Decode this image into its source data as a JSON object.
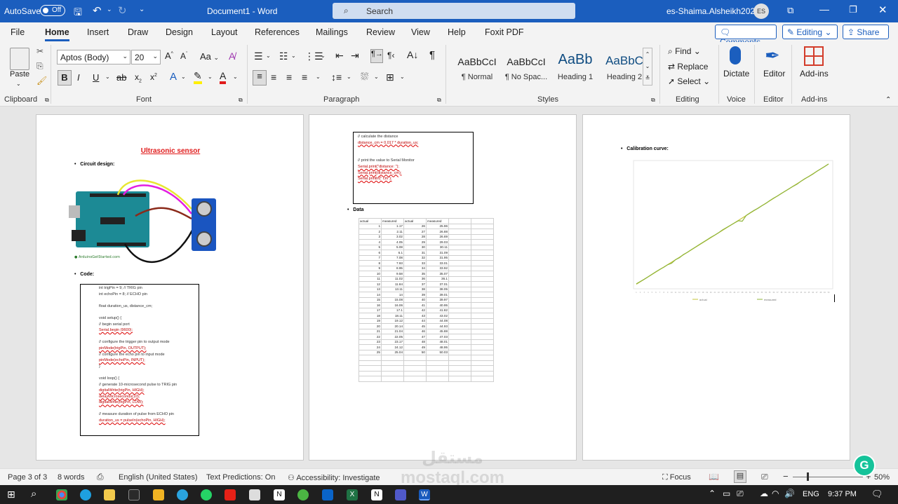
{
  "titlebar": {
    "autosave_label": "AutoSave",
    "autosave_state": "Off",
    "doc_title": "Document1 - Word",
    "search_placeholder": "Search",
    "user_name": "es-Shaima.Alsheikh2026",
    "user_initials": "ES"
  },
  "tabs": [
    "File",
    "Home",
    "Insert",
    "Draw",
    "Design",
    "Layout",
    "References",
    "Mailings",
    "Review",
    "View",
    "Help",
    "Foxit PDF"
  ],
  "active_tab": "Home",
  "actions": {
    "comments": "Comments",
    "editing": "Editing",
    "share": "Share"
  },
  "ribbon": {
    "clipboard": {
      "paste": "Paste",
      "label": "Clipboard"
    },
    "font": {
      "name": "Aptos (Body)",
      "size": "20",
      "label": "Font",
      "change_case": "Aa"
    },
    "paragraph": {
      "label": "Paragraph"
    },
    "styles": {
      "label": "Styles",
      "items": [
        {
          "preview": "AaBbCcI",
          "name": "¶ Normal"
        },
        {
          "preview": "AaBbCcI",
          "name": "¶ No Spac..."
        },
        {
          "preview": "AaBb",
          "name": "Heading 1"
        },
        {
          "preview": "AaBbC",
          "name": "Heading 2"
        }
      ]
    },
    "editing": {
      "find": "Find",
      "replace": "Replace",
      "select": "Select",
      "label": "Editing"
    },
    "voice": {
      "dictate": "Dictate",
      "label": "Voice"
    },
    "editor": {
      "editor": "Editor",
      "label": "Editor"
    },
    "addins": {
      "addins": "Add-ins",
      "label": "Add-ins"
    }
  },
  "page1": {
    "title": "Ultrasonic sensor",
    "bullet1": "Circuit design:",
    "bullet2": "Code:",
    "code": [
      "int trigPin = 9;   // TRIG pin",
      "int echoPin = 8;   // ECHO pin",
      "",
      "float duration_us, distance_cm;",
      "",
      "void setup() {",
      "  // begin serial port",
      "  Serial.begin (9600);",
      "",
      "  // configure the trigger pin to output mode",
      "  pinMode(trigPin, OUTPUT);",
      "  // configure the echo pin to input mode",
      "  pinMode(echoPin, INPUT);",
      "}",
      "",
      "void loop() {",
      "  // generate 10-microsecond pulse to TRIG pin",
      "  digitalWrite(trigPin, HIGH);",
      "  delayMicroseconds(10);",
      "  digitalWrite(trigPin, LOW);",
      "",
      "  // measure duration of pulse from ECHO pin",
      "  duration_us = pulseIn(echoPin, HIGH);"
    ]
  },
  "page2": {
    "code": [
      "// calculate the distance",
      "distance_cm = 0.017 * duration_us;",
      "",
      "",
      "// print the value to Serial Monitor",
      "Serial.print(\"distance: \");",
      "Serial.print(distance_cm);",
      "Serial.println(\" cm\");"
    ],
    "bullet": "Data",
    "table_headers": [
      "actual",
      "measured",
      "actual",
      "measured",
      "",
      ""
    ],
    "table_rows": [
      [
        "1",
        "1.17",
        "26",
        "25.96"
      ],
      [
        "2",
        "2.11",
        "27",
        "26.88"
      ],
      [
        "3",
        "3.02",
        "28",
        "26.69"
      ],
      [
        "4",
        "4.05",
        "29",
        "29.03"
      ],
      [
        "5",
        "5.08",
        "30",
        "30.11"
      ],
      [
        "6",
        "6.1",
        "31",
        "31.09"
      ],
      [
        "7",
        "7.08",
        "32",
        "31.95"
      ],
      [
        "8",
        "7.93",
        "33",
        "33.01"
      ],
      [
        "9",
        "8.95",
        "34",
        "33.92"
      ],
      [
        "10",
        "9.58",
        "35",
        "35.07"
      ],
      [
        "11",
        "11.02",
        "36",
        "36.1"
      ],
      [
        "12",
        "11.84",
        "37",
        "37.01"
      ],
      [
        "13",
        "13.11",
        "38",
        "38.05"
      ],
      [
        "14",
        "14",
        "39",
        "39.01"
      ],
      [
        "15",
        "15.08",
        "40",
        "39.97"
      ],
      [
        "16",
        "16.06",
        "41",
        "40.95"
      ],
      [
        "17",
        "17.1",
        "42",
        "41.82"
      ],
      [
        "18",
        "18.11",
        "43",
        "43.02"
      ],
      [
        "19",
        "19.12",
        "44",
        "44.08"
      ],
      [
        "20",
        "20.14",
        "45",
        "44.93"
      ],
      [
        "21",
        "21.04",
        "46",
        "45.88"
      ],
      [
        "22",
        "22.05",
        "47",
        "47.03"
      ],
      [
        "23",
        "23.17",
        "48",
        "48.01"
      ],
      [
        "24",
        "24.12",
        "49",
        "48.95"
      ],
      [
        "25",
        "25.04",
        "50",
        "50.03"
      ]
    ]
  },
  "page3": {
    "bullet": "Calibration curve:"
  },
  "chart_data": {
    "type": "line",
    "x": [
      1,
      2,
      3,
      4,
      5,
      6,
      7,
      8,
      9,
      10,
      11,
      12,
      13,
      14,
      15,
      16,
      17,
      18,
      19,
      20,
      21,
      22,
      23,
      24,
      25,
      26,
      27,
      28,
      29,
      30,
      31,
      32,
      33,
      34,
      35,
      36,
      37,
      38,
      39,
      40,
      41,
      42,
      43,
      44,
      45,
      46,
      47,
      48,
      49,
      50
    ],
    "series": [
      {
        "name": "actual",
        "values": [
          1,
          2,
          3,
          4,
          5,
          6,
          7,
          8,
          9,
          10,
          11,
          12,
          13,
          14,
          15,
          16,
          17,
          18,
          19,
          20,
          21,
          22,
          23,
          24,
          25,
          26,
          27,
          28,
          29,
          30,
          31,
          32,
          33,
          34,
          35,
          36,
          37,
          38,
          39,
          40,
          41,
          42,
          43,
          44,
          45,
          46,
          47,
          48,
          49,
          50
        ],
        "color": "#c6c63a"
      },
      {
        "name": "measured",
        "values": [
          1.17,
          2.11,
          3.02,
          4.05,
          5.08,
          6.1,
          7.08,
          7.93,
          8.95,
          9.58,
          11.02,
          11.84,
          13.11,
          14,
          15.08,
          16.06,
          17.1,
          18.11,
          19.12,
          20.14,
          21.04,
          22.05,
          23.17,
          24.12,
          25.04,
          25.96,
          26.88,
          26.69,
          29.03,
          30.11,
          31.09,
          31.95,
          33.01,
          33.92,
          35.07,
          36.1,
          37.01,
          38.05,
          39.01,
          39.97,
          40.95,
          41.82,
          43.02,
          44.08,
          44.93,
          45.88,
          47.03,
          48.01,
          48.95,
          50.03
        ],
        "color": "#8fb43a"
      }
    ],
    "legend": "bottom"
  },
  "status": {
    "page": "Page 3 of 3",
    "words": "8 words",
    "language": "English (United States)",
    "predictions": "Text Predictions: On",
    "accessibility": "Accessibility: Investigate",
    "focus": "Focus",
    "zoom": "50%"
  },
  "taskbar": {
    "lang": "ENG",
    "time": "9:37 PM"
  },
  "watermark": "مستقل mostaql.com"
}
